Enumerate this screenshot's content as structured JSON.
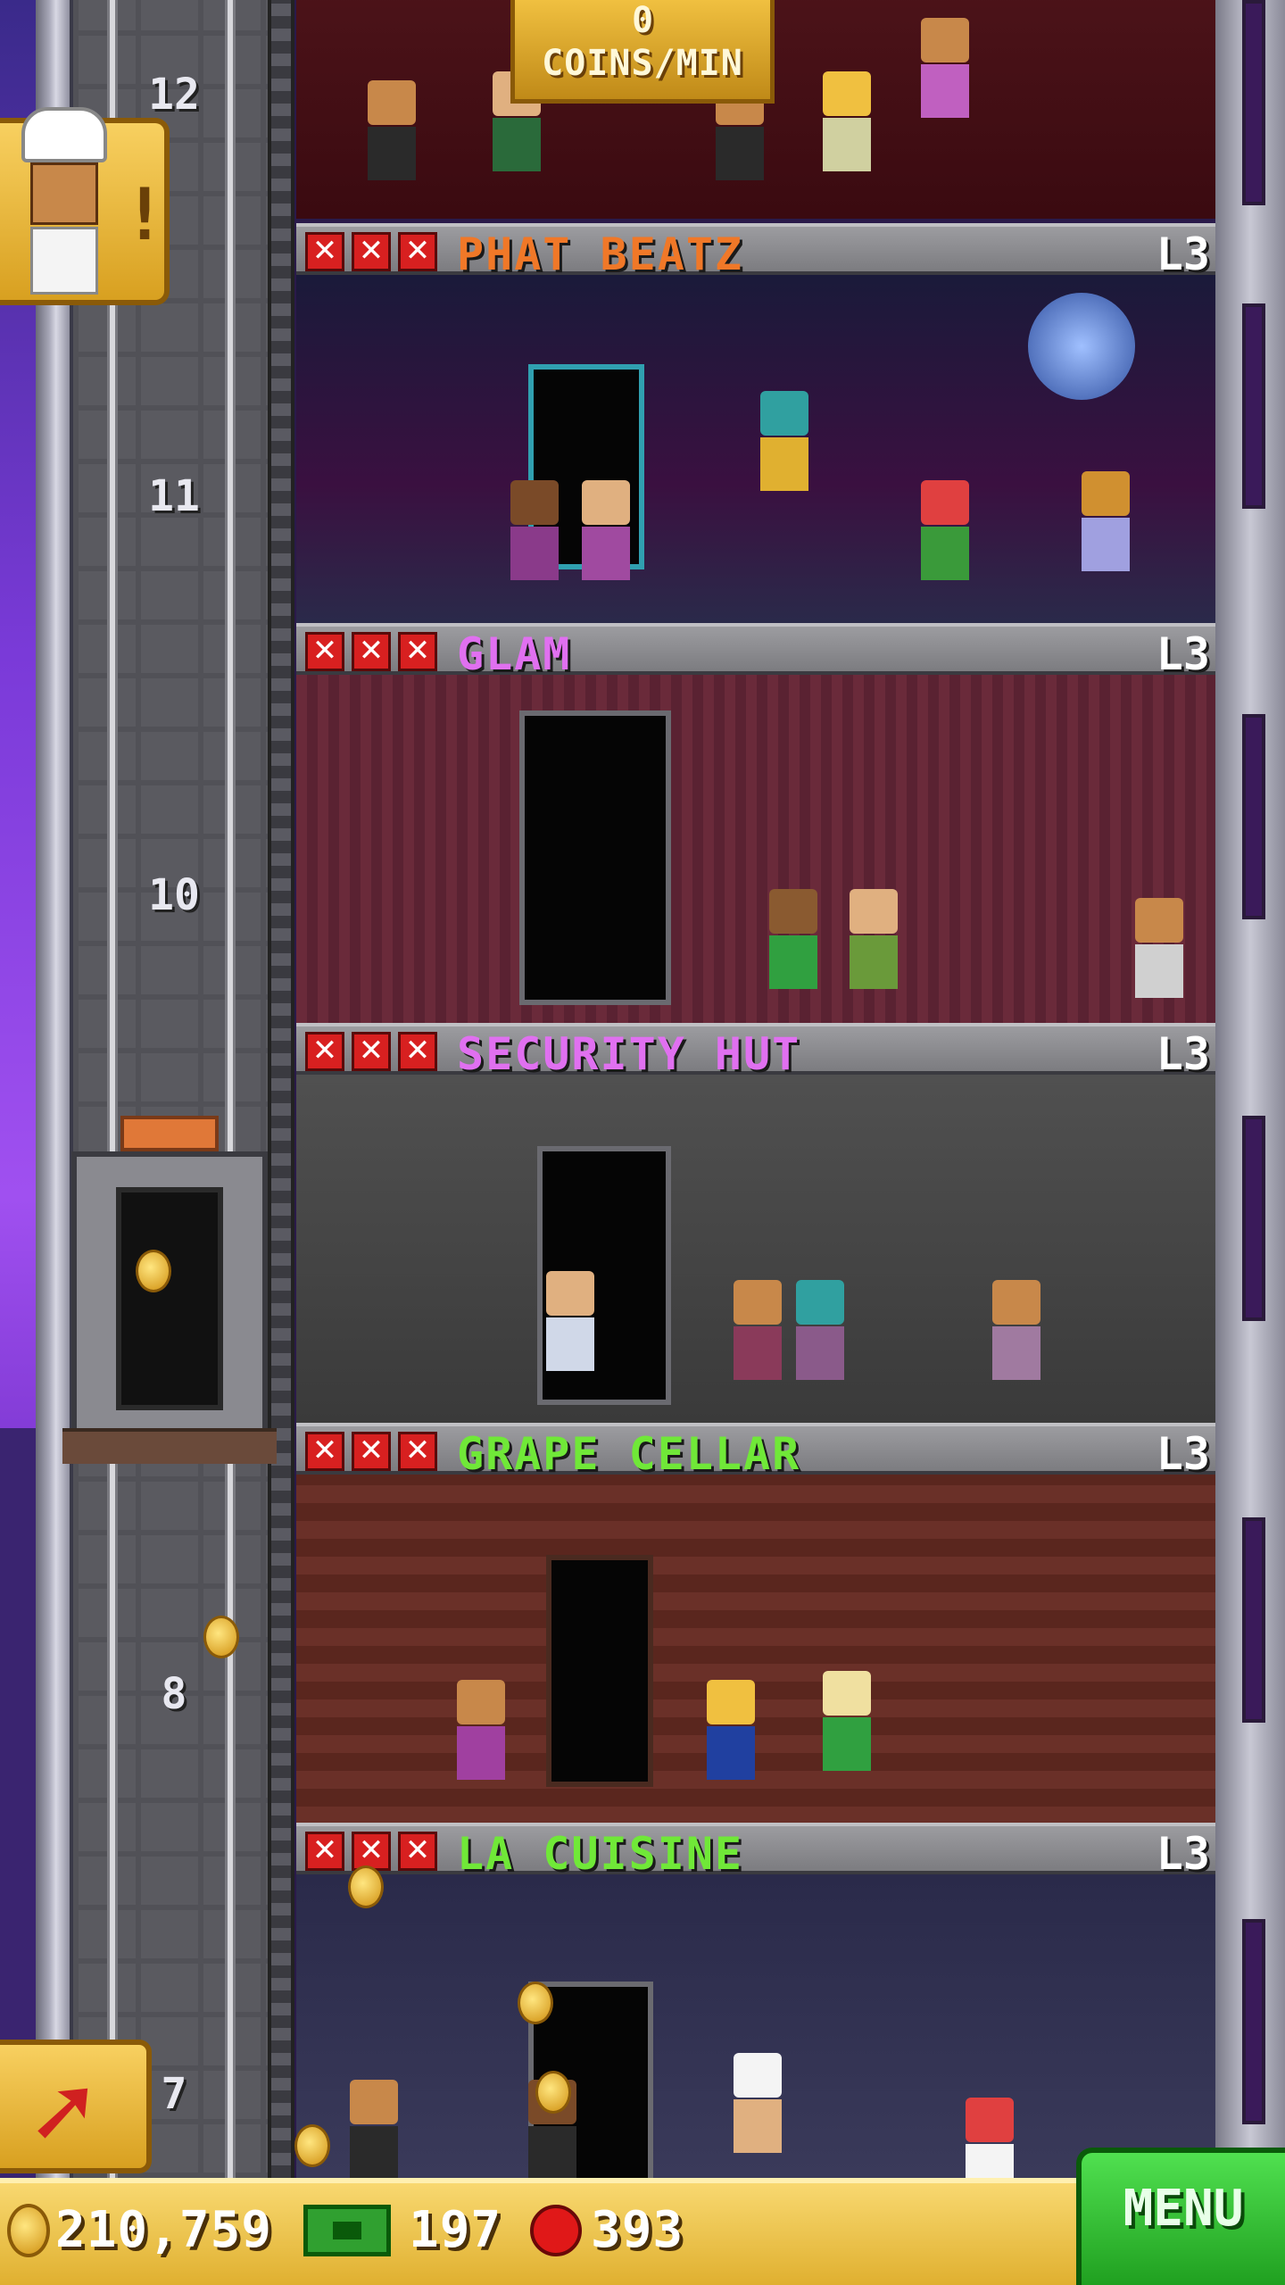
{
  "coin_rate": {
    "value": "0",
    "unit": "COINS/MIN"
  },
  "floor_numbers": [
    "12",
    "11",
    "10",
    "8",
    "7"
  ],
  "floors": [
    {
      "name": "PHAT BEATZ",
      "level": "L3",
      "color": "#f07828",
      "stock_icons": "x,x,x"
    },
    {
      "name": "GLAM",
      "level": "L3",
      "color": "#e070f0",
      "stock_icons": "x,x,x"
    },
    {
      "name": "SECURITY HUT",
      "level": "L3",
      "color": "#e070f0",
      "stock_icons": "x,x,x"
    },
    {
      "name": "GRAPE CELLAR",
      "level": "L3",
      "color": "#70e838",
      "stock_icons": "x,x,x"
    },
    {
      "name": "LA CUISINE",
      "level": "L3",
      "color": "#70e838",
      "stock_icons": "x,x,x"
    }
  ],
  "status_bar": {
    "coins": "210,759",
    "bux": "197",
    "tickets": "393",
    "menu_label": "MENU"
  },
  "notification": {
    "icon": "chef-icon",
    "badge": "!"
  },
  "raise_button": {
    "icon": "arrow-up-right-icon"
  }
}
